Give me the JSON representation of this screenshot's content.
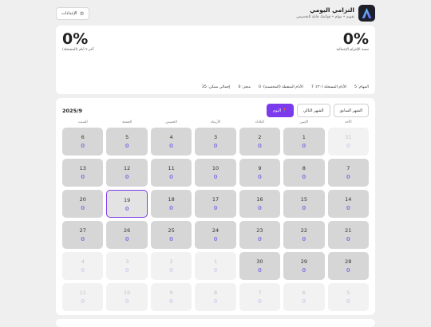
{
  "header": {
    "title": "التزامي اليومي",
    "subtitle": "تقويم • مهام • قوائمك قابلة للتخصيص",
    "settings_label": "الإعدادات"
  },
  "stats": {
    "main_rate": "0%",
    "main_rate_label": "نسبة الإلتزام الإجمالية",
    "side_rate": "0%",
    "side_rate_label": "آخر ٧ أيام (المسجلة)",
    "metrics_row1": [
      "المهام: 5",
      "الأيام المسجلة (٣٠): 7",
      "الأيام المنقطة (المحتسبة): 0",
      "منجز: 0",
      "إجمالي ممكن: 35"
    ],
    "metrics_row2": [
      "وزن: — كغم",
      "محيط الخصر: — سم",
      "مدة الرياضة: — دقيقة"
    ]
  },
  "calendar": {
    "month_title": "2025/9",
    "prev_label": "الشهر السابق",
    "next_label": "الشهر التالي",
    "today_label": "اليوم",
    "today_icon": "pin-icon",
    "weekdays": [
      "الأحد",
      "الإثنين",
      "الثلاثاء",
      "الأربعاء",
      "الخميس",
      "الجمعة",
      "السبت"
    ],
    "days": [
      {
        "n": "31",
        "c": "0",
        "other": true
      },
      {
        "n": "1",
        "c": "0"
      },
      {
        "n": "2",
        "c": "0"
      },
      {
        "n": "3",
        "c": "0"
      },
      {
        "n": "4",
        "c": "0"
      },
      {
        "n": "5",
        "c": "0"
      },
      {
        "n": "6",
        "c": "0"
      },
      {
        "n": "7",
        "c": "0"
      },
      {
        "n": "8",
        "c": "0"
      },
      {
        "n": "9",
        "c": "0"
      },
      {
        "n": "10",
        "c": "0"
      },
      {
        "n": "11",
        "c": "0"
      },
      {
        "n": "12",
        "c": "0"
      },
      {
        "n": "13",
        "c": "0"
      },
      {
        "n": "14",
        "c": "0"
      },
      {
        "n": "15",
        "c": "0"
      },
      {
        "n": "16",
        "c": "0"
      },
      {
        "n": "17",
        "c": "0"
      },
      {
        "n": "18",
        "c": "0"
      },
      {
        "n": "19",
        "c": "0",
        "selected": true
      },
      {
        "n": "20",
        "c": "0"
      },
      {
        "n": "21",
        "c": "0"
      },
      {
        "n": "22",
        "c": "0"
      },
      {
        "n": "23",
        "c": "0"
      },
      {
        "n": "24",
        "c": "0"
      },
      {
        "n": "25",
        "c": "0"
      },
      {
        "n": "26",
        "c": "0"
      },
      {
        "n": "27",
        "c": "0"
      },
      {
        "n": "28",
        "c": "0"
      },
      {
        "n": "29",
        "c": "0"
      },
      {
        "n": "30",
        "c": "0"
      },
      {
        "n": "1",
        "c": "0",
        "other": true
      },
      {
        "n": "2",
        "c": "0",
        "other": true
      },
      {
        "n": "3",
        "c": "0",
        "other": true
      },
      {
        "n": "4",
        "c": "0",
        "other": true
      },
      {
        "n": "5",
        "c": "0",
        "other": true
      },
      {
        "n": "6",
        "c": "0",
        "other": true
      },
      {
        "n": "7",
        "c": "0",
        "other": true
      },
      {
        "n": "8",
        "c": "0",
        "other": true
      },
      {
        "n": "9",
        "c": "0",
        "other": true
      },
      {
        "n": "10",
        "c": "0",
        "other": true
      },
      {
        "n": "11",
        "c": "0",
        "other": true
      }
    ]
  },
  "colors": {
    "accent": "#7c3aed",
    "count": "#8b7be0",
    "logo_bg": "#1d1f2b"
  }
}
